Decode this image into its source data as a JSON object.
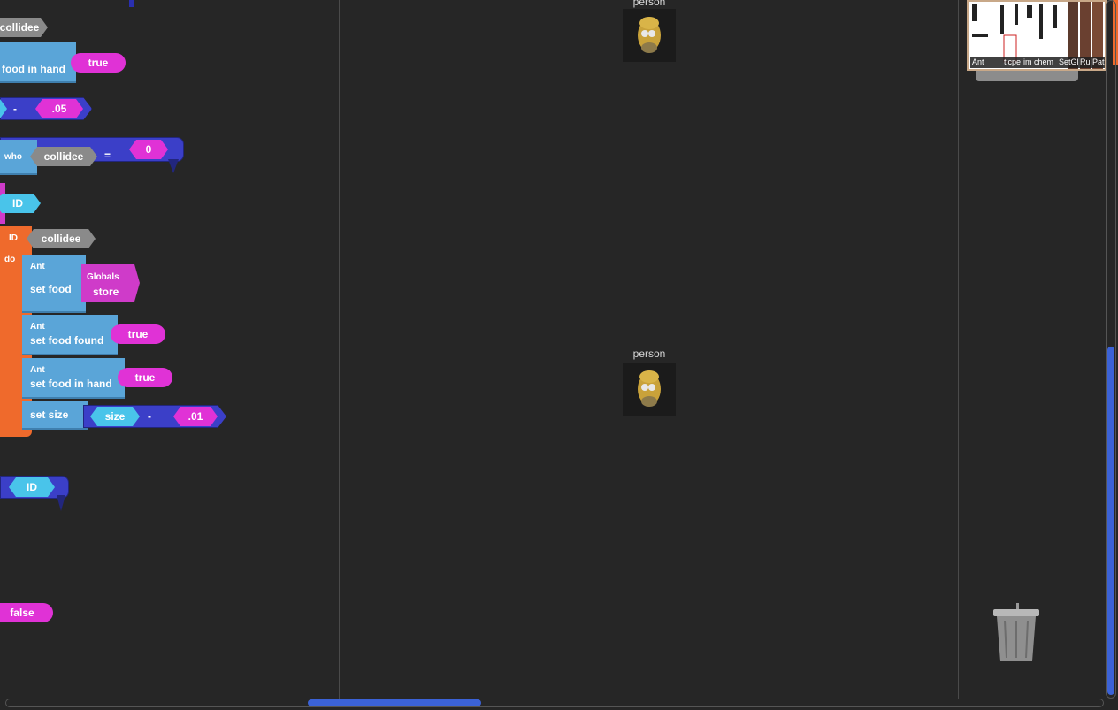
{
  "blocks": {
    "collidee_top": "collidee",
    "food_in_hand_label": "food in hand",
    "true_1": "true",
    "minus_1": "-",
    "val_05": ".05",
    "who_label": "who",
    "collidee_2": "collidee",
    "equals": "=",
    "zero": "0",
    "id_1": "ID",
    "id_2": "ID",
    "collidee_3": "collidee",
    "do_label": "do",
    "ant_1": "Ant",
    "set_food": "set food",
    "globals_label": "Globals",
    "store_label": "store",
    "ant_2": "Ant",
    "set_food_found": "set food found",
    "true_2": "true",
    "ant_3": "Ant",
    "set_food_in_hand": "set food in hand",
    "true_3": "true",
    "set_size": "set size",
    "size_label": "size",
    "minus_2": "-",
    "val_01": ".01",
    "id_3": "ID",
    "false_1": "false"
  },
  "stage": {
    "sprite_top_label": "person",
    "sprite_mid_label": "person"
  },
  "minimap": {
    "tabs": [
      "Ant",
      "ticpe",
      "im",
      "chem",
      "SetGl",
      "Ru",
      "Pat"
    ]
  },
  "colors": {
    "workspace_bg": "#262626",
    "block_blue": "#5aa5d8",
    "block_magenta": "#e032d6",
    "block_cyan": "#49c4ea",
    "block_orange": "#ef6a2c",
    "scroll_blue": "#3b62d6"
  }
}
